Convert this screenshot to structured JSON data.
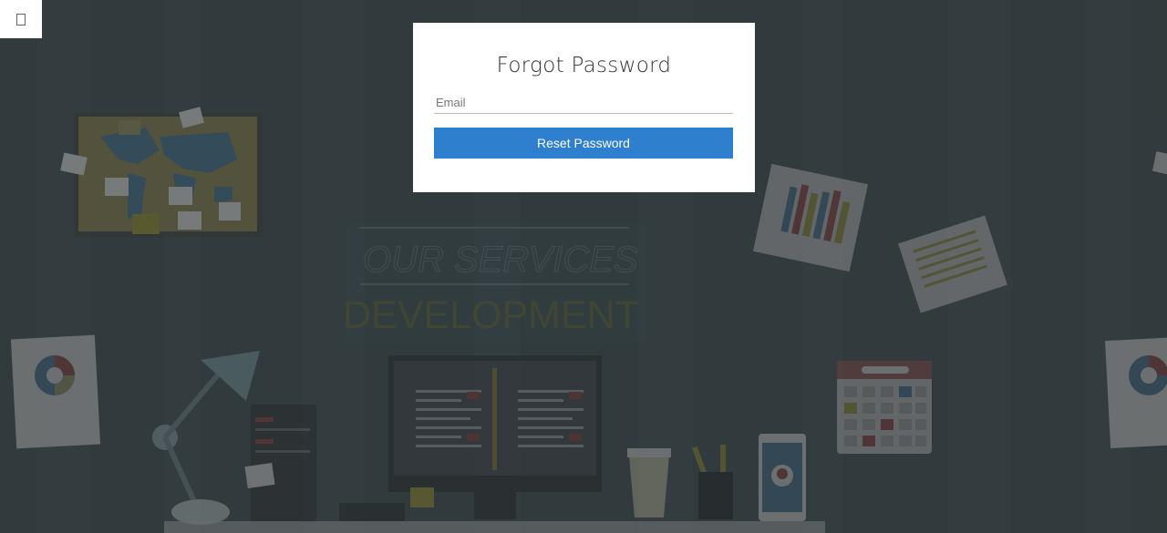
{
  "modal": {
    "title": "Forgot Password",
    "email_placeholder": "Email",
    "email_value": "",
    "reset_label": "Reset Password",
    "button_color": "#2f7fcf"
  },
  "background": {
    "services_heading": "OUR SERVICES",
    "development_heading": "DEVELOPMENT"
  },
  "corner": {
    "icon": "square-outline-icon"
  }
}
